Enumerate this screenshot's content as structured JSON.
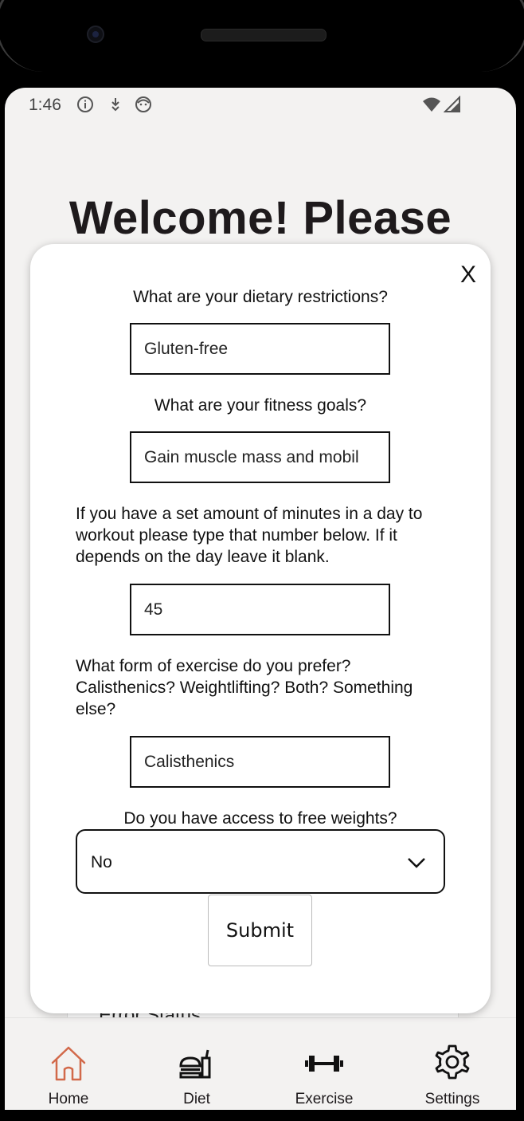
{
  "status_bar": {
    "time": "1:46",
    "icons": [
      "info-icon",
      "download-icon",
      "face-icon",
      "wifi-icon",
      "signal-icon"
    ]
  },
  "page": {
    "heading": "Welcome! Please",
    "background_item": "Error Status"
  },
  "modal": {
    "close_label": "X",
    "questions": {
      "dietary_restrictions": "What are your dietary restrictions?",
      "fitness_goals": "What are your fitness goals?",
      "workout_minutes": "If you have a set amount of minutes in a day to workout please type that number below. If it depends on the day leave it blank.",
      "exercise_form": "What form of exercise do you prefer? Calisthenics? Weightlifting? Both? Something else?",
      "free_weights": "Do you have access to free weights?"
    },
    "values": {
      "dietary_restrictions": "Gluten-free",
      "fitness_goals": "Gain muscle mass and mobil",
      "workout_minutes": "45",
      "exercise_form": "Calisthenics",
      "free_weights": "No"
    },
    "submit_label": "Submit"
  },
  "bottom_nav": {
    "items": [
      {
        "label": "Home",
        "icon": "home-icon",
        "active": true
      },
      {
        "label": "Diet",
        "icon": "burger-drink-icon",
        "active": false
      },
      {
        "label": "Exercise",
        "icon": "dumbbell-icon",
        "active": false
      },
      {
        "label": "Settings",
        "icon": "gear-icon",
        "active": false
      }
    ]
  },
  "colors": {
    "accent": "#d2694a",
    "screen_background": "#f3f2f1",
    "text": "#1e1a1c"
  }
}
